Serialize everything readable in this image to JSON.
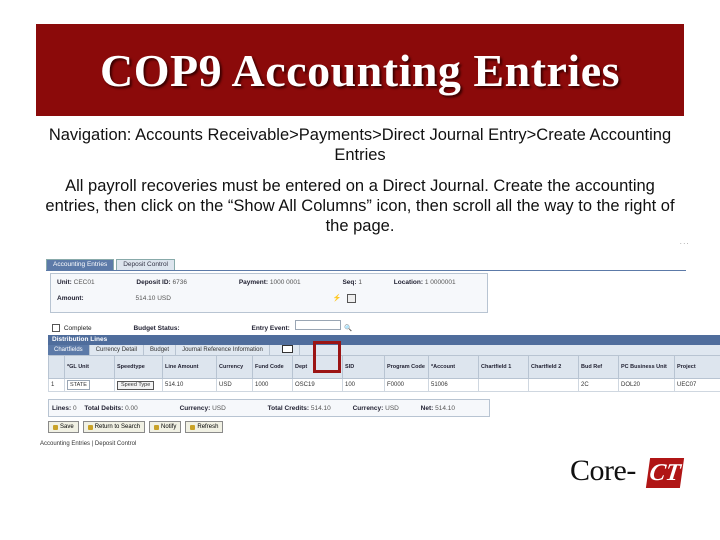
{
  "slide": {
    "title": "COP9 Accounting Entries",
    "navigation": "Navigation: Accounts Receivable>Payments>Direct Journal Entry>Create Accounting Entries",
    "instructions": "All payroll recoveries must be entered on a Direct Journal.  Create the accounting entries, then click on the “Show All Columns” icon, then scroll all the way to the right of the page."
  },
  "screenshot": {
    "tabs": [
      {
        "label": "Accounting Entries",
        "active": true
      },
      {
        "label": "Deposit Control",
        "active": false
      }
    ],
    "header": {
      "unit_label": "Unit:",
      "unit_value": "CEC01",
      "deposit_label": "Deposit ID:",
      "deposit_value": "6736",
      "payment_label": "Payment:",
      "payment_value": "1000 0001",
      "seq_label": "Seq:",
      "seq_value": "1",
      "location_label": "Location:",
      "location_value": "1 0000001",
      "amount_label": "Amount:",
      "amount_value": "514.10  USD"
    },
    "options": {
      "complete_label": "Complete",
      "budget_label": "Budget Status:",
      "entry_event_label": "Entry Event:"
    },
    "grid": {
      "title": "Distribution Lines",
      "tabs": [
        "Chartfields",
        "Currency Detail",
        "Budget",
        "Journal Reference Information"
      ],
      "columns": [
        "",
        "*GL Unit",
        "Speedtype",
        "Line Amount",
        "Currency",
        "Fund Code",
        "Dept",
        "SID",
        "Program Code",
        "*Account",
        "Chartfield 1",
        "Chartfield 2",
        "Bud Ref",
        "PC Business Unit",
        "Project"
      ],
      "row": [
        "1",
        "STATE",
        "Speed Type",
        "514.10",
        "USD",
        "1000",
        "OSC19",
        "100",
        "F0000",
        "51006",
        "",
        "",
        "2C",
        "DOL20",
        "UEC07"
      ]
    },
    "totals": {
      "lines_label": "Lines:",
      "lines_value": "0",
      "debits_label": "Total Debits:",
      "debits_value": "0.00",
      "currency_label": "Currency:",
      "currency_value": "USD",
      "credits_label": "Total Credits:",
      "credits_value": "514.10",
      "currency2_label": "Currency:",
      "currency2_value": "USD",
      "net_label": "Net:",
      "net_value": "514.10"
    },
    "buttons": [
      {
        "label": "Save",
        "icon": "save-icon"
      },
      {
        "label": "Return to Search",
        "icon": "return-icon"
      },
      {
        "label": "Notify",
        "icon": "notify-icon"
      },
      {
        "label": "Refresh",
        "icon": "refresh-icon"
      }
    ],
    "footer_links": "Accounting Entries | Deposit Control"
  },
  "logo": {
    "text_core": "Core-",
    "text_ct": "CT"
  },
  "colors": {
    "title_bg": "#8b0a0a",
    "highlight": "#9b1414",
    "tab_active": "#5c7aa8"
  }
}
